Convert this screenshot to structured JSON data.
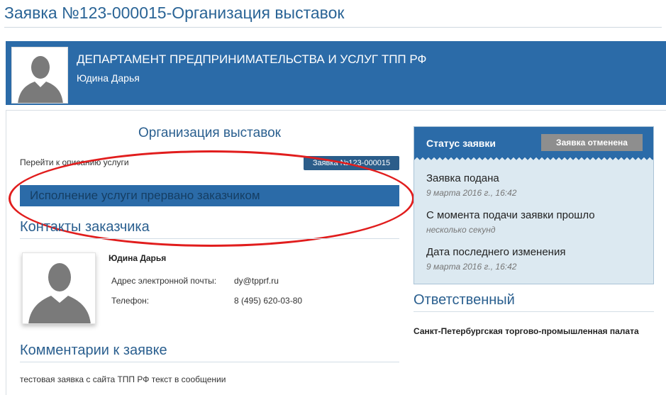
{
  "page": {
    "title": "Заявка №123-000015-Организация выставок"
  },
  "department": {
    "name": "ДЕПАРТАМЕНТ ПРЕДПРИНИМАТЕЛЬСТВА И УСЛУГ ТПП РФ",
    "user": "Юдина Дарья"
  },
  "service": {
    "title": "Организация выставок",
    "link_label": "Перейти к описанию услуги",
    "order_badge": "Заявка №123-000015",
    "status_banner": "Исполнение услуги прервано заказчиком"
  },
  "contacts": {
    "heading": "Контакты заказчика",
    "name": "Юдина Дарья",
    "email_label": "Адрес электронной почты:",
    "email_value": "dy@tpprf.ru",
    "phone_label": "Телефон:",
    "phone_value": "8 (495) 620-03-80"
  },
  "comments": {
    "heading": "Комментарии к заявке",
    "text": "тестовая заявка с сайта ТПП РФ текст в сообщении"
  },
  "status_panel": {
    "title": "Статус заявки",
    "button_label": "Заявка отменена",
    "items": [
      {
        "label": "Заявка подана",
        "value": "9 марта 2016 г., 16:42"
      },
      {
        "label": "С момента подачи заявки прошло",
        "value": "несколько секунд"
      },
      {
        "label": "Дата последнего изменения",
        "value": "9 марта 2016 г., 16:42"
      }
    ]
  },
  "responsible": {
    "heading": "Ответственный",
    "org": "Санкт-Петербургская торгово-промышленная палата"
  },
  "icons": {
    "dept_avatar": "user-silhouette-icon",
    "customer_avatar": "user-silhouette-icon"
  },
  "colors": {
    "accent": "#2b6ba8",
    "heading": "#2a5f8f",
    "annotation": "#e11d1d",
    "panel_bg": "#dce9f1",
    "button": "#8e8e8e"
  }
}
